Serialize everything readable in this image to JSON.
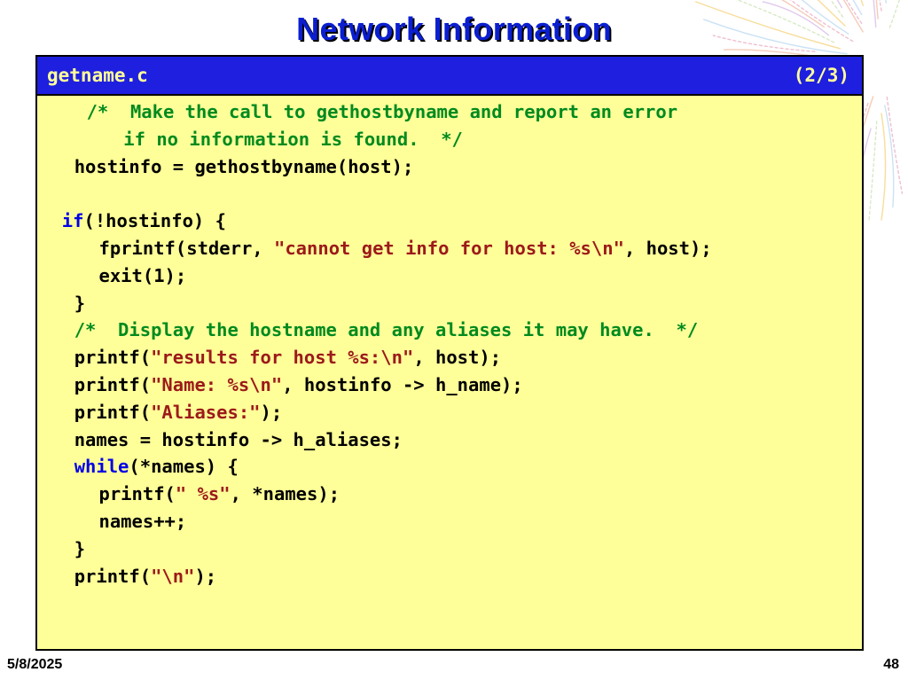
{
  "slide": {
    "title": "Network Information",
    "date": "5/8/2025",
    "page_number": "48"
  },
  "code": {
    "filename": "getname.c",
    "part": "(2/3)",
    "lines": [
      {
        "indent": 4,
        "parts": [
          {
            "t": "/*  Make the call to gethostbyname and report an error",
            "c": "cm"
          }
        ]
      },
      {
        "indent": 7,
        "parts": [
          {
            "t": "if no information is found.  */",
            "c": "cm"
          }
        ]
      },
      {
        "indent": 3,
        "parts": [
          {
            "t": "hostinfo = gethostbyname(host);",
            "c": "pl"
          }
        ]
      },
      {
        "indent": 0,
        "parts": []
      },
      {
        "indent": 2,
        "parts": [
          {
            "t": "if",
            "c": "kw"
          },
          {
            "t": "(!hostinfo) {",
            "c": "pl"
          }
        ]
      },
      {
        "indent": 5,
        "parts": [
          {
            "t": "fprintf(stderr, ",
            "c": "pl"
          },
          {
            "t": "\"cannot get info for host: %s\\n\"",
            "c": "st"
          },
          {
            "t": ", host);",
            "c": "pl"
          }
        ]
      },
      {
        "indent": 5,
        "parts": [
          {
            "t": "exit(1);",
            "c": "pl"
          }
        ]
      },
      {
        "indent": 3,
        "parts": [
          {
            "t": "}",
            "c": "pl"
          }
        ]
      },
      {
        "indent": 3,
        "parts": [
          {
            "t": "/*  Display the hostname and any aliases it may have.  */",
            "c": "cm"
          }
        ]
      },
      {
        "indent": 3,
        "parts": [
          {
            "t": "printf(",
            "c": "pl"
          },
          {
            "t": "\"results for host %s:\\n\"",
            "c": "st"
          },
          {
            "t": ", host);",
            "c": "pl"
          }
        ]
      },
      {
        "indent": 3,
        "parts": [
          {
            "t": "printf(",
            "c": "pl"
          },
          {
            "t": "\"Name: %s\\n\"",
            "c": "st"
          },
          {
            "t": ", hostinfo -> h_name);",
            "c": "pl"
          }
        ]
      },
      {
        "indent": 3,
        "parts": [
          {
            "t": "printf(",
            "c": "pl"
          },
          {
            "t": "\"Aliases:\"",
            "c": "st"
          },
          {
            "t": ");",
            "c": "pl"
          }
        ]
      },
      {
        "indent": 3,
        "parts": [
          {
            "t": "names = hostinfo -> h_aliases;",
            "c": "pl"
          }
        ]
      },
      {
        "indent": 3,
        "parts": [
          {
            "t": "while",
            "c": "kw"
          },
          {
            "t": "(*names) {",
            "c": "pl"
          }
        ]
      },
      {
        "indent": 5,
        "parts": [
          {
            "t": "printf(",
            "c": "pl"
          },
          {
            "t": "\" %s\"",
            "c": "st"
          },
          {
            "t": ", *names);",
            "c": "pl"
          }
        ]
      },
      {
        "indent": 5,
        "parts": [
          {
            "t": "names++;",
            "c": "pl"
          }
        ]
      },
      {
        "indent": 3,
        "parts": [
          {
            "t": "}",
            "c": "pl"
          }
        ]
      },
      {
        "indent": 3,
        "parts": [
          {
            "t": "printf(",
            "c": "pl"
          },
          {
            "t": "\"\\n\"",
            "c": "st"
          },
          {
            "t": ");",
            "c": "pl"
          }
        ]
      }
    ]
  },
  "colors": {
    "title": "#0b1fd0",
    "header_bg": "#1f1fe0",
    "header_text": "#ffff99",
    "code_bg": "#ffff99",
    "comment": "#008a1e",
    "keyword": "#0000e6",
    "string": "#9c1a1a"
  },
  "decoration": {
    "icon": "fireworks-icon"
  }
}
